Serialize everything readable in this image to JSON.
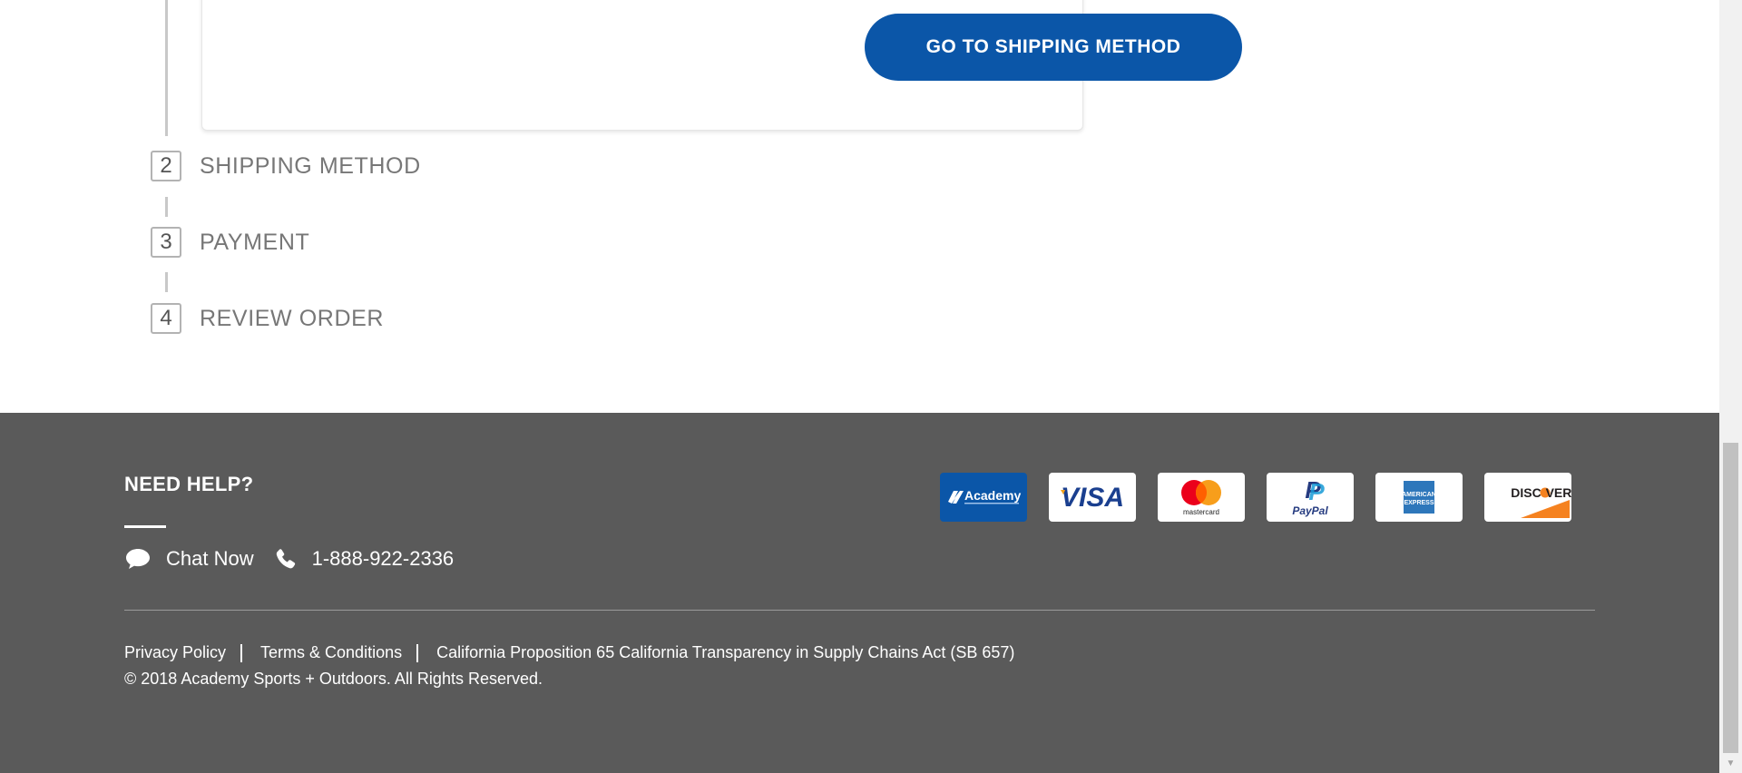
{
  "checkout": {
    "continue_button": "GO TO SHIPPING METHOD",
    "steps": [
      {
        "number": "2",
        "label": "SHIPPING METHOD"
      },
      {
        "number": "3",
        "label": "PAYMENT"
      },
      {
        "number": "4",
        "label": "REVIEW ORDER"
      }
    ]
  },
  "footer": {
    "need_help": "NEED HELP?",
    "chat_label": "Chat Now",
    "phone": "1-888-922-2336",
    "payment_cards": [
      {
        "name": "Academy",
        "icon": "academy-card-icon"
      },
      {
        "name": "VISA",
        "icon": "visa-card-icon"
      },
      {
        "name": "mastercard",
        "icon": "mastercard-card-icon"
      },
      {
        "name": "PayPal",
        "icon": "paypal-card-icon"
      },
      {
        "name": "AMERICAN EXPRESS",
        "icon": "amex-card-icon"
      },
      {
        "name": "DISCOVER",
        "icon": "discover-card-icon"
      }
    ],
    "links": {
      "privacy": "Privacy Policy",
      "terms": "Terms & Conditions",
      "california": "California Proposition 65 California Transparency in Supply Chains Act (SB 657)"
    },
    "copyright": "© 2018 Academy Sports + Outdoors. All Rights Reserved."
  },
  "colors": {
    "primary_button": "#0b56a8",
    "footer_background": "#5a5a5a",
    "step_text": "#777777"
  }
}
